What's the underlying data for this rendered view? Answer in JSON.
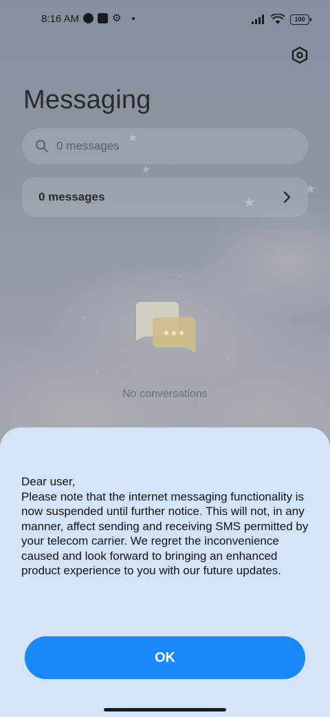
{
  "status_bar": {
    "time": "8:16 AM",
    "battery": "100"
  },
  "header": {
    "title": "Messaging",
    "settings_icon": "settings-hexagon-icon"
  },
  "search": {
    "placeholder": "0 messages"
  },
  "messages_row": {
    "label": "0 messages"
  },
  "empty_state": {
    "text": "No conversations",
    "icon": "chat-bubbles-icon"
  },
  "dialog": {
    "message": "Dear user,\nPlease note that the internet messaging functionality is now suspended until further notice. This will not, in any manner, affect sending and receiving SMS permitted by your telecom carrier. We regret the inconvenience caused and look forward to bringing an enhanced product experience to you with our future updates.",
    "ok_label": "OK"
  },
  "colors": {
    "accent": "#1887f7",
    "sheet_background": "#d3e4f9"
  }
}
